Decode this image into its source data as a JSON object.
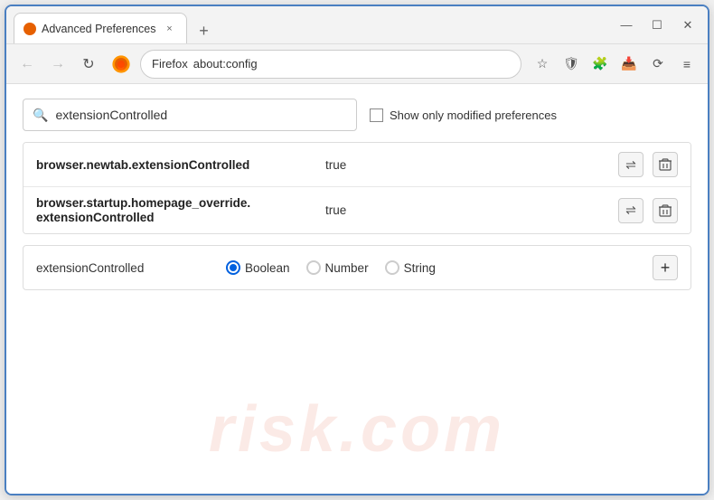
{
  "window": {
    "title": "Advanced Preferences",
    "tab_close_label": "×",
    "new_tab_label": "+",
    "minimize_label": "—",
    "maximize_label": "☐",
    "close_label": "✕"
  },
  "nav": {
    "back_label": "←",
    "forward_label": "→",
    "refresh_label": "↻",
    "browser_label": "Firefox",
    "address": "about:config",
    "star_icon": "☆",
    "shield_icon": "🛡",
    "extensions_icon": "🧩",
    "download_icon": "📥",
    "sync_icon": "⟳",
    "menu_icon": "≡"
  },
  "search": {
    "placeholder": "extensionControlled",
    "value": "extensionControlled",
    "show_modified_label": "Show only modified preferences"
  },
  "results": {
    "rows": [
      {
        "name": "browser.newtab.extensionControlled",
        "value": "true",
        "multiline": false
      },
      {
        "name_line1": "browser.startup.homepage_override.",
        "name_line2": "extensionControlled",
        "value": "true",
        "multiline": true
      }
    ],
    "reset_icon": "⇌",
    "delete_icon": "🗑"
  },
  "add_row": {
    "name": "extensionControlled",
    "types": [
      "Boolean",
      "Number",
      "String"
    ],
    "selected_type": "Boolean",
    "plus_label": "+"
  },
  "watermark": {
    "text": "risk.com"
  }
}
